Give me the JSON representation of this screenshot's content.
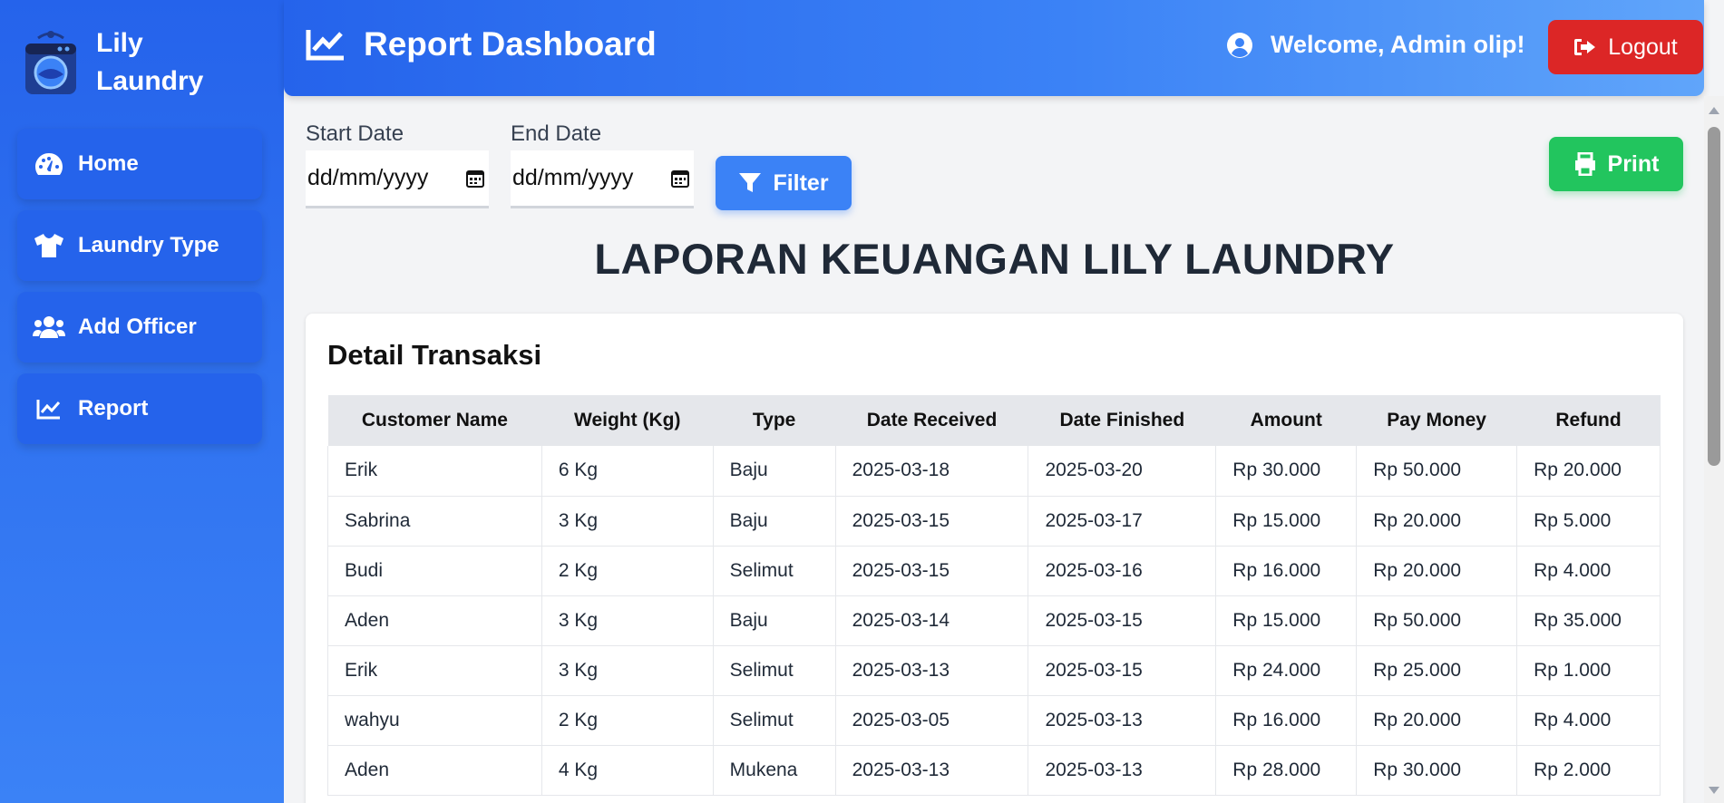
{
  "brand": {
    "name": "Lily Laundry"
  },
  "sidebar": {
    "items": [
      {
        "label": "Home",
        "icon": "speedometer-icon"
      },
      {
        "label": "Laundry Type",
        "icon": "shirt-icon"
      },
      {
        "label": "Add Officer",
        "icon": "users-icon"
      },
      {
        "label": "Report",
        "icon": "chart-line-icon"
      }
    ]
  },
  "header": {
    "title": "Report Dashboard",
    "welcome": "Welcome, Admin olip!",
    "logout_label": "Logout"
  },
  "filters": {
    "start_label": "Start Date",
    "start_value": "dd/mm/yyyy",
    "end_label": "End Date",
    "end_value": "dd/mm/yyyy",
    "filter_label": "Filter",
    "print_label": "Print"
  },
  "report": {
    "title": "LAPORAN KEUANGAN LILY LAUNDRY",
    "section_title": "Detail Transaksi",
    "columns": [
      "Customer Name",
      "Weight (Kg)",
      "Type",
      "Date Received",
      "Date Finished",
      "Amount",
      "Pay Money",
      "Refund"
    ],
    "rows": [
      [
        "Erik",
        "6 Kg",
        "Baju",
        "2025-03-18",
        "2025-03-20",
        "Rp 30.000",
        "Rp 50.000",
        "Rp 20.000"
      ],
      [
        "Sabrina",
        "3 Kg",
        "Baju",
        "2025-03-15",
        "2025-03-17",
        "Rp 15.000",
        "Rp 20.000",
        "Rp 5.000"
      ],
      [
        "Budi",
        "2 Kg",
        "Selimut",
        "2025-03-15",
        "2025-03-16",
        "Rp 16.000",
        "Rp 20.000",
        "Rp 4.000"
      ],
      [
        "Aden",
        "3 Kg",
        "Baju",
        "2025-03-14",
        "2025-03-15",
        "Rp 15.000",
        "Rp 50.000",
        "Rp 35.000"
      ],
      [
        "Erik",
        "3 Kg",
        "Selimut",
        "2025-03-13",
        "2025-03-15",
        "Rp 24.000",
        "Rp 25.000",
        "Rp 1.000"
      ],
      [
        "wahyu",
        "2 Kg",
        "Selimut",
        "2025-03-05",
        "2025-03-13",
        "Rp 16.000",
        "Rp 20.000",
        "Rp 4.000"
      ],
      [
        "Aden",
        "4 Kg",
        "Mukena",
        "2025-03-13",
        "2025-03-13",
        "Rp 28.000",
        "Rp 30.000",
        "Rp 2.000"
      ]
    ]
  },
  "colors": {
    "primary": "#2563eb",
    "danger": "#dc2626",
    "success": "#22c55e",
    "filter": "#3b82f6"
  }
}
